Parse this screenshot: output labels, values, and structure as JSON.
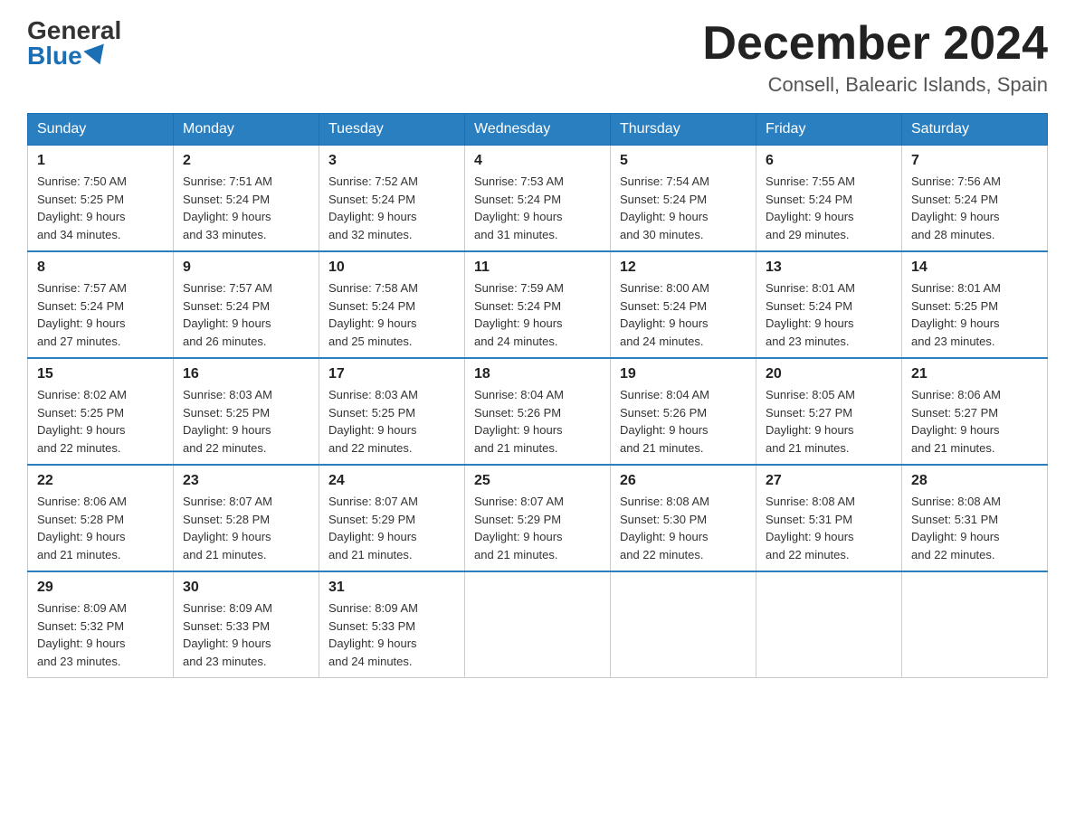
{
  "header": {
    "logo_general": "General",
    "logo_blue": "Blue",
    "month_title": "December 2024",
    "location": "Consell, Balearic Islands, Spain"
  },
  "days_of_week": [
    "Sunday",
    "Monday",
    "Tuesday",
    "Wednesday",
    "Thursday",
    "Friday",
    "Saturday"
  ],
  "weeks": [
    [
      {
        "day": "1",
        "sunrise": "7:50 AM",
        "sunset": "5:25 PM",
        "daylight": "9 hours and 34 minutes."
      },
      {
        "day": "2",
        "sunrise": "7:51 AM",
        "sunset": "5:24 PM",
        "daylight": "9 hours and 33 minutes."
      },
      {
        "day": "3",
        "sunrise": "7:52 AM",
        "sunset": "5:24 PM",
        "daylight": "9 hours and 32 minutes."
      },
      {
        "day": "4",
        "sunrise": "7:53 AM",
        "sunset": "5:24 PM",
        "daylight": "9 hours and 31 minutes."
      },
      {
        "day": "5",
        "sunrise": "7:54 AM",
        "sunset": "5:24 PM",
        "daylight": "9 hours and 30 minutes."
      },
      {
        "day": "6",
        "sunrise": "7:55 AM",
        "sunset": "5:24 PM",
        "daylight": "9 hours and 29 minutes."
      },
      {
        "day": "7",
        "sunrise": "7:56 AM",
        "sunset": "5:24 PM",
        "daylight": "9 hours and 28 minutes."
      }
    ],
    [
      {
        "day": "8",
        "sunrise": "7:57 AM",
        "sunset": "5:24 PM",
        "daylight": "9 hours and 27 minutes."
      },
      {
        "day": "9",
        "sunrise": "7:57 AM",
        "sunset": "5:24 PM",
        "daylight": "9 hours and 26 minutes."
      },
      {
        "day": "10",
        "sunrise": "7:58 AM",
        "sunset": "5:24 PM",
        "daylight": "9 hours and 25 minutes."
      },
      {
        "day": "11",
        "sunrise": "7:59 AM",
        "sunset": "5:24 PM",
        "daylight": "9 hours and 24 minutes."
      },
      {
        "day": "12",
        "sunrise": "8:00 AM",
        "sunset": "5:24 PM",
        "daylight": "9 hours and 24 minutes."
      },
      {
        "day": "13",
        "sunrise": "8:01 AM",
        "sunset": "5:24 PM",
        "daylight": "9 hours and 23 minutes."
      },
      {
        "day": "14",
        "sunrise": "8:01 AM",
        "sunset": "5:25 PM",
        "daylight": "9 hours and 23 minutes."
      }
    ],
    [
      {
        "day": "15",
        "sunrise": "8:02 AM",
        "sunset": "5:25 PM",
        "daylight": "9 hours and 22 minutes."
      },
      {
        "day": "16",
        "sunrise": "8:03 AM",
        "sunset": "5:25 PM",
        "daylight": "9 hours and 22 minutes."
      },
      {
        "day": "17",
        "sunrise": "8:03 AM",
        "sunset": "5:25 PM",
        "daylight": "9 hours and 22 minutes."
      },
      {
        "day": "18",
        "sunrise": "8:04 AM",
        "sunset": "5:26 PM",
        "daylight": "9 hours and 21 minutes."
      },
      {
        "day": "19",
        "sunrise": "8:04 AM",
        "sunset": "5:26 PM",
        "daylight": "9 hours and 21 minutes."
      },
      {
        "day": "20",
        "sunrise": "8:05 AM",
        "sunset": "5:27 PM",
        "daylight": "9 hours and 21 minutes."
      },
      {
        "day": "21",
        "sunrise": "8:06 AM",
        "sunset": "5:27 PM",
        "daylight": "9 hours and 21 minutes."
      }
    ],
    [
      {
        "day": "22",
        "sunrise": "8:06 AM",
        "sunset": "5:28 PM",
        "daylight": "9 hours and 21 minutes."
      },
      {
        "day": "23",
        "sunrise": "8:07 AM",
        "sunset": "5:28 PM",
        "daylight": "9 hours and 21 minutes."
      },
      {
        "day": "24",
        "sunrise": "8:07 AM",
        "sunset": "5:29 PM",
        "daylight": "9 hours and 21 minutes."
      },
      {
        "day": "25",
        "sunrise": "8:07 AM",
        "sunset": "5:29 PM",
        "daylight": "9 hours and 21 minutes."
      },
      {
        "day": "26",
        "sunrise": "8:08 AM",
        "sunset": "5:30 PM",
        "daylight": "9 hours and 22 minutes."
      },
      {
        "day": "27",
        "sunrise": "8:08 AM",
        "sunset": "5:31 PM",
        "daylight": "9 hours and 22 minutes."
      },
      {
        "day": "28",
        "sunrise": "8:08 AM",
        "sunset": "5:31 PM",
        "daylight": "9 hours and 22 minutes."
      }
    ],
    [
      {
        "day": "29",
        "sunrise": "8:09 AM",
        "sunset": "5:32 PM",
        "daylight": "9 hours and 23 minutes."
      },
      {
        "day": "30",
        "sunrise": "8:09 AM",
        "sunset": "5:33 PM",
        "daylight": "9 hours and 23 minutes."
      },
      {
        "day": "31",
        "sunrise": "8:09 AM",
        "sunset": "5:33 PM",
        "daylight": "9 hours and 24 minutes."
      },
      null,
      null,
      null,
      null
    ]
  ],
  "labels": {
    "sunrise": "Sunrise:",
    "sunset": "Sunset:",
    "daylight": "Daylight:"
  }
}
